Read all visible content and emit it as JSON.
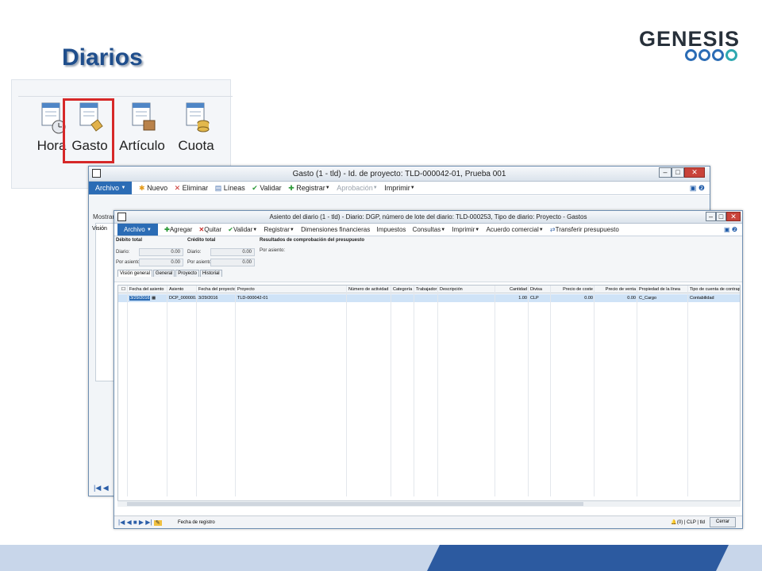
{
  "slide": {
    "title": "Diarios",
    "brand": "GENESIS",
    "ring_colors": [
      "#2b6cb5",
      "#2b6cb5",
      "#2b6cb5",
      "#2fa8b0"
    ]
  },
  "ribbon": {
    "buttons": [
      {
        "label": "Hora"
      },
      {
        "label": "Gasto"
      },
      {
        "label": "Artículo"
      },
      {
        "label": "Cuota"
      }
    ],
    "selected": "Gasto"
  },
  "win1": {
    "title": "Gasto (1 - tld) - Id. de proyecto: TLD-000042-01, Prueba 001",
    "menu": {
      "archivo": "Archivo",
      "nuevo": "Nuevo",
      "eliminar": "Eliminar",
      "lineas": "Líneas",
      "validar": "Validar",
      "registrar": "Registrar",
      "aprobacion": "Aprobación",
      "imprimir": "Imprimir"
    },
    "mostrar": "Mostrar",
    "vision": "Visión"
  },
  "win2": {
    "title": "Asiento del diario (1 - tld) - Diario: DGP, número de lote del diario: TLD-000253, Tipo de diario: Proyecto - Gastos",
    "menu": {
      "archivo": "Archivo",
      "agregar": "Agregar",
      "quitar": "Quitar",
      "validar": "Validar",
      "registrar": "Registrar",
      "dimensiones": "Dimensiones financieras",
      "impuestos": "Impuestos",
      "consultas": "Consultas",
      "imprimir": "Imprimir",
      "acuerdo": "Acuerdo comercial",
      "transferir": "Transferir presupuesto"
    },
    "summary": {
      "debito_total": "Débito total",
      "credito_total": "Crédito total",
      "resultados": "Resultados de comprobación del presupuesto",
      "diario": "Diario:",
      "por_asiento": "Por asiento:",
      "diario_debit": "0.00",
      "asiento_debit": "0.00",
      "diario_credit": "0.00",
      "asiento_credit": "0.00",
      "por_asiento_result": "Por asiento:"
    },
    "tabs": [
      "Visión general",
      "General",
      "Proyecto",
      "Historial"
    ],
    "columns": [
      "Fecha del asiento",
      "Asiento",
      "Fecha del proyecto",
      "Proyecto",
      "Número de actividad",
      "Categoría",
      "Trabajador",
      "Descripción",
      "Cantidad",
      "Divisa",
      "Precio de coste",
      "Precio de venta",
      "Propiedad de la línea",
      "Tipo de cuenta de contrapar"
    ],
    "row": [
      "3/29/2016",
      "DCP_000000...",
      "3/29/2016",
      "TLD-000042-01",
      "",
      "",
      "",
      "",
      "1.00",
      "CLP",
      "0.00",
      "0.00",
      "C_Cargo",
      "Contabilidad"
    ],
    "status": {
      "fecha": "Fecha de registro",
      "count": "(0)",
      "currency": "CLP",
      "company": "tld",
      "cerrar": "Cerrar"
    }
  }
}
